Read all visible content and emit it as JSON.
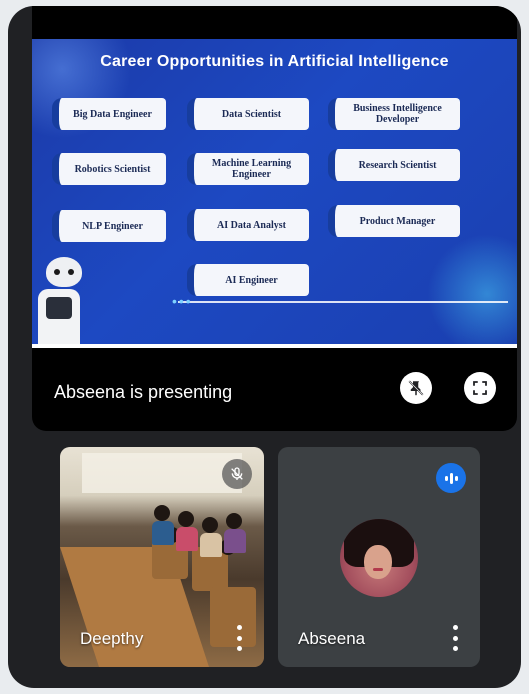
{
  "slide": {
    "title": "Career Opportunities in Artificial Intelligence",
    "careers": [
      "Big Data Engineer",
      "Data Scientist",
      "Business Intelligence Developer",
      "Robotics Scientist",
      "Machine Learning Engineer",
      "Research Scientist",
      "NLP Engineer",
      "AI Data Analyst",
      "Product Manager",
      "AI Engineer"
    ]
  },
  "presentation": {
    "status_text": "Abseena is presenting",
    "stop_presenting_icon": "pin-off-icon",
    "fullscreen_icon": "fullscreen-icon"
  },
  "participants": [
    {
      "name": "Deepthy",
      "mic_icon": "mic-off-icon",
      "menu_icon": "more-vert-icon"
    },
    {
      "name": "Abseena",
      "mic_icon": "speaking-indicator-icon",
      "menu_icon": "more-vert-icon"
    }
  ],
  "colors": {
    "background": "#202124",
    "accent": "#1a73e8",
    "slide_blue": "#1d49c2"
  }
}
